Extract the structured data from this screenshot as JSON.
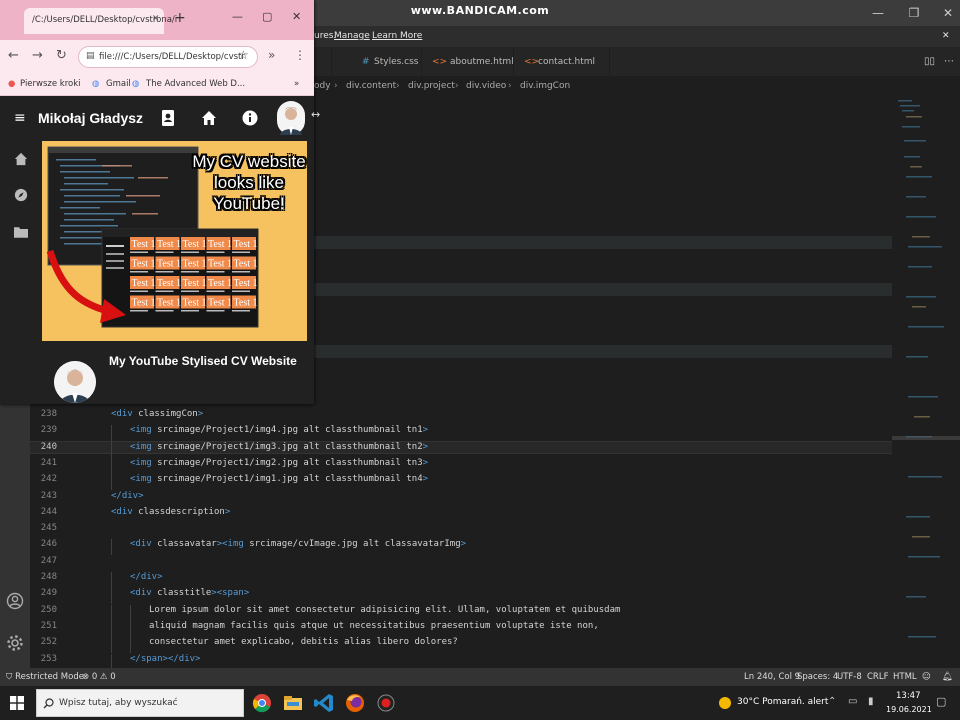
{
  "recorder": {
    "watermark": "www.BANDICAM.com"
  },
  "vscode": {
    "restricted_text": "ures.",
    "manage_link": "Manage",
    "learn_more_link": "Learn More",
    "tabs": [
      "Styles.css",
      "aboutme.html",
      "contact.html"
    ],
    "breadcrumb": [
      "ody",
      "div.content",
      "div.project",
      "div.video",
      "div.imgCon"
    ],
    "code_lines": [
      {
        "n": "238",
        "code": "<div class=\"imgCon\">",
        "indent": 1
      },
      {
        "n": "239",
        "code": "<img src=\"image/Project1/img4.jpg\" alt=\"\" class=\"thumbnail tn1\">",
        "indent": 2
      },
      {
        "n": "240",
        "code": "<img src=\"image/Project1/img3.jpg\" alt=\"\" class=\"thumbnail tn2\">",
        "indent": 2
      },
      {
        "n": "241",
        "code": "<img src=\"image/Project1/img2.jpg\" alt=\"\" class=\"thumbnail tn3\">",
        "indent": 2
      },
      {
        "n": "242",
        "code": "<img src=\"image/Project1/img1.jpg\" alt=\"\" class=\"thumbnail tn4\">",
        "indent": 2
      },
      {
        "n": "243",
        "code": "</div>",
        "indent": 1
      },
      {
        "n": "244",
        "code": "<div class=\"description\">",
        "indent": 1
      },
      {
        "n": "245",
        "code": "",
        "indent": 1
      },
      {
        "n": "246",
        "code": "<div class=\"avatar\"><img src=\"image/cvImage.jpg\" alt=\"\" class=\"avatarImg\">",
        "indent": 2
      },
      {
        "n": "247",
        "code": "",
        "indent": 1
      },
      {
        "n": "248",
        "code": "</div>",
        "indent": 2
      },
      {
        "n": "249",
        "code": "<div class=\"title\"><span>",
        "indent": 2
      },
      {
        "n": "250",
        "code": "Lorem ipsum dolor sit amet consectetur adipisicing elit. Ullam, voluptatem et quibusdam",
        "indent": 3
      },
      {
        "n": "251",
        "code": "aliquid magnam facilis quis atque ut necessitatibus praesentium voluptate iste non,",
        "indent": 3
      },
      {
        "n": "252",
        "code": "consectetur amet explicabo, debitis alias libero dolores?",
        "indent": 3
      },
      {
        "n": "253",
        "code": "</span></div>",
        "indent": 2
      }
    ],
    "status": {
      "restricted": "Restricted Mode",
      "problems": "⊗ 0 ⚠ 0",
      "position": "Ln 240, Col 9",
      "spaces": "Spaces: 4",
      "encoding": "UTF-8",
      "eol": "CRLF",
      "language": "HTML"
    }
  },
  "chrome": {
    "tab_title": "/C:/Users/DELL/Desktop/cvstrona/i",
    "url": "file:///C:/Users/DELL/Desktop/cvstr",
    "bookmarks": [
      "Pierwsze kroki",
      "Gmail",
      "The Advanced Web D..."
    ]
  },
  "site": {
    "name": "Mikołaj Gładysz",
    "thumb_caption_1": "My CV website",
    "thumb_caption_2": "looks like",
    "thumb_caption_3": "YouTube!",
    "video_title": "My YouTube Stylised CV Website",
    "test_label": "Test 1"
  },
  "taskbar": {
    "search_placeholder": "Wpisz tutaj, aby wyszukać",
    "weather": "30°C  Pomarań. alert",
    "time": "13:47",
    "date": "19.06.2021"
  }
}
